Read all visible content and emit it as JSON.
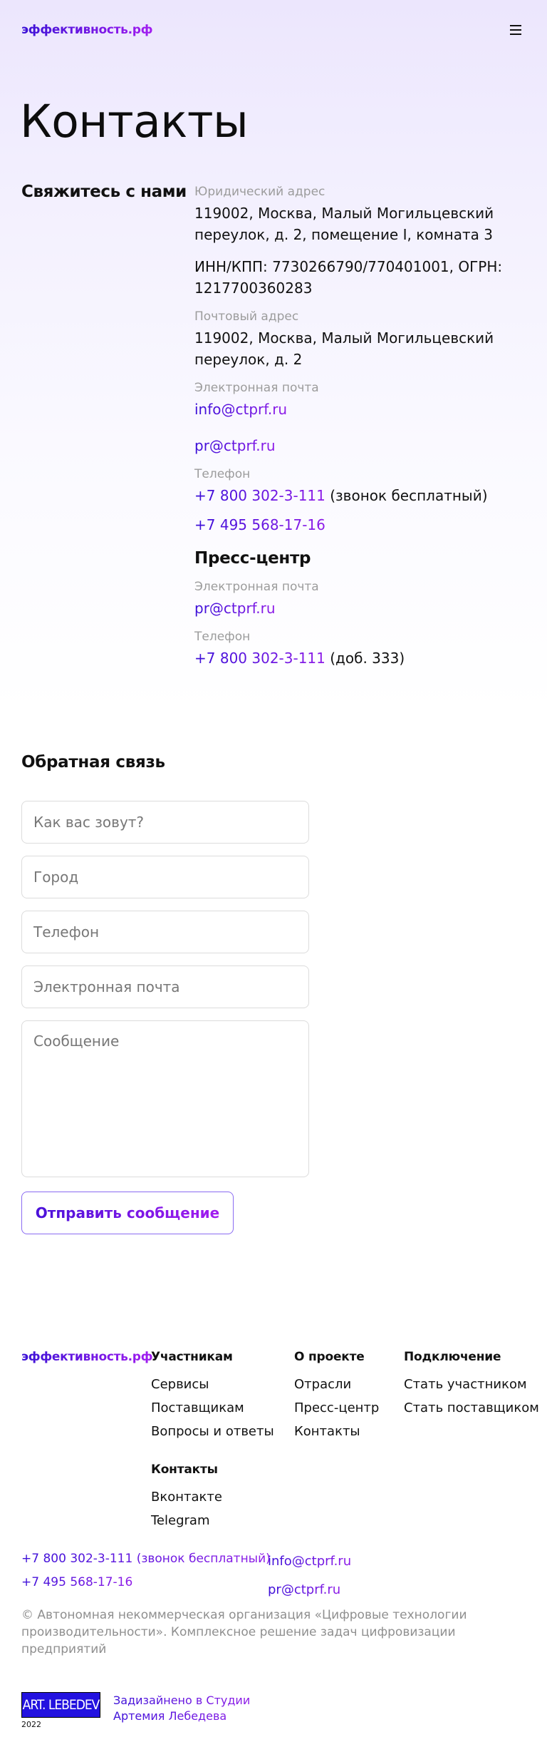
{
  "header": {
    "logo": "эффективность.рф"
  },
  "page_title": "Контакты",
  "contact_heading": "Свяжитесь с нами",
  "contacts": {
    "legal_label": "Юридический адрес",
    "legal_address": "119002, Москва, Малый Могильцевский переулок, д. 2, помещение I, комната 3",
    "inn": "ИНН/КПП: 7730266790/770401001, ОГРН: 1217700360283",
    "postal_label": "Почтовый адрес",
    "postal_address": "119002, Москва, Малый Могильцевский переулок, д. 2",
    "email_label": "Электронная почта",
    "email_1": "info@ctprf.ru",
    "email_2": "pr@ctprf.ru",
    "phone_label": "Телефон",
    "phone_1": "+7 800 302-3-111",
    "phone_1_note": " (звонок бесплатный)",
    "phone_2": "+7 495 568-17-16"
  },
  "press": {
    "title": "Пресс-центр",
    "email_label": "Электронная почта",
    "email": "pr@ctprf.ru",
    "phone_label": "Телефон",
    "phone": "+7 800 302-3-111",
    "phone_note": " (доб. 333)"
  },
  "feedback": {
    "title": "Обратная связь",
    "name_placeholder": "Как вас зовут?",
    "city_placeholder": "Город",
    "phone_placeholder": "Телефон",
    "email_placeholder": "Электронная почта",
    "message_placeholder": "Сообщение",
    "submit_label": "Отправить сообщение"
  },
  "footer": {
    "logo": "эффективность.рф",
    "col_participants": {
      "title": "Участникам",
      "links": [
        "Сервисы",
        "Поставщикам",
        "Вопросы и ответы"
      ]
    },
    "col_about": {
      "title": "О проекте",
      "links": [
        "Отрасли",
        "Пресс-центр",
        "Контакты"
      ]
    },
    "col_connect": {
      "title": "Подключение",
      "links": [
        "Стать участником",
        "Стать поставщиком"
      ]
    },
    "col_contacts": {
      "title": "Контакты",
      "links": [
        "Вконтакте",
        "Telegram"
      ]
    },
    "phone_1": "+7 800 302-3-111 (звонок бесплатный)",
    "phone_2": "+7 495 568-17-16",
    "email_1": "info@ctprf.ru",
    "email_2": "pr@ctprf.ru",
    "copyright": "© Автономная некоммерческая организация «Цифровые технологии производительности». Комплексное решение задач цифровизации предприятий",
    "studio_logo": "ART. LEBEDEV",
    "studio_year": "2022",
    "studio_line_1": "Задизайнено в Студии",
    "studio_line_2": "Артемия Лебедева"
  },
  "colors": {
    "accent_blue": "#3e10da",
    "accent_violet": "#a21cf0",
    "studio_blue": "#2312e0"
  },
  "icons": {
    "menu": "burger-menu-icon"
  }
}
